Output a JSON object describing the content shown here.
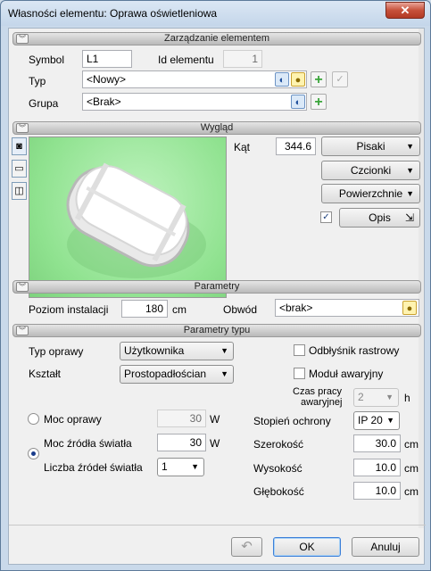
{
  "window": {
    "title": "Własności elementu: Oprawa oświetleniowa",
    "close_label": "✕"
  },
  "sections": {
    "zarzadzanie": "Zarządzanie elementem",
    "wyglad": "Wygląd",
    "parametry": "Parametry",
    "parametry_typu": "Parametry typu"
  },
  "zarzadzanie": {
    "symbol_label": "Symbol",
    "symbol_value": "L1",
    "id_label": "Id elementu",
    "id_value": "1",
    "typ_label": "Typ",
    "typ_value": "<Nowy>",
    "grupa_label": "Grupa",
    "grupa_value": "<Brak>"
  },
  "wyglad": {
    "kat_label": "Kąt",
    "kat_value": "344.6",
    "pisaki": "Pisaki",
    "czcionki": "Czcionki",
    "powierzchnie": "Powierzchnie",
    "opis": "Opis",
    "opis_checked": true
  },
  "parametry": {
    "poziom_label": "Poziom instalacji",
    "poziom_value": "180",
    "poziom_unit": "cm",
    "obwod_label": "Obwód",
    "obwod_value": "<brak>"
  },
  "parametry_typu": {
    "typ_oprawy_label": "Typ oprawy",
    "typ_oprawy_value": "Użytkownika",
    "ksztalt_label": "Kształt",
    "ksztalt_value": "Prostopadłościan",
    "odblysnik_label": "Odbłyśnik rastrowy",
    "odblysnik_checked": false,
    "modul_label": "Moduł awaryjny",
    "modul_checked": false,
    "czas_label_1": "Czas pracy",
    "czas_label_2": "awaryjnej",
    "czas_value": "2",
    "czas_unit": "h",
    "moc_oprawy_label": "Moc oprawy",
    "moc_oprawy_value": "30",
    "moc_oprawy_unit": "W",
    "moc_zrodla_label": "Moc źródła światła",
    "moc_zrodla_value": "30",
    "moc_zrodla_unit": "W",
    "liczba_label": "Liczba źródeł światła",
    "liczba_value": "1",
    "stopien_label": "Stopień ochrony",
    "stopien_value": "IP 20",
    "szerokosc_label": "Szerokość",
    "szerokosc_value": "30.0",
    "wysokosc_label": "Wysokość",
    "wysokosc_value": "10.0",
    "glebokosc_label": "Głębokość",
    "glebokosc_value": "10.0",
    "unit_cm": "cm",
    "selected_power": "moc_zrodla"
  },
  "footer": {
    "ok": "OK",
    "anuluj": "Anuluj"
  },
  "icons": {
    "checked": "✓",
    "dropdown": "▼",
    "plus": "+",
    "arrow_corner": "⇲",
    "undo": "↶",
    "chevron": "≚"
  },
  "colors": {
    "plus_green": "#3aa53a",
    "accent_blue": "#3c7fd8",
    "close_red": "#c7513b",
    "preview_green": "#8fe28f"
  }
}
